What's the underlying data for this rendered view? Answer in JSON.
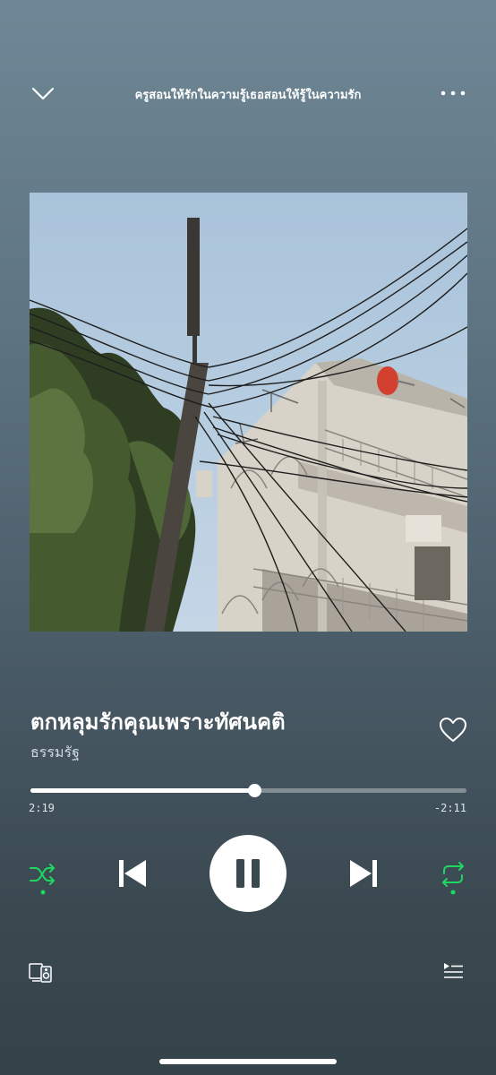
{
  "header": {
    "playlist_title": "ครูสอนให้รักในความรู้เธอสอนให้รู้ในความรัก"
  },
  "track": {
    "title": "ตกหลุมรักคุณเพราะทัศนคติ",
    "artist": "ธรรมรัฐ"
  },
  "progress": {
    "elapsed": "2:19",
    "remaining": "-2:11",
    "fraction": 0.515
  },
  "colors": {
    "accent": "#1ed760",
    "background_top": "#6f8796",
    "background_bottom": "#34424a"
  },
  "icons": {
    "collapse": "chevron-down-icon",
    "more": "more-horizontal-icon",
    "like": "heart-icon",
    "shuffle": "shuffle-icon",
    "previous": "skip-previous-icon",
    "pause": "pause-icon",
    "next": "skip-next-icon",
    "repeat": "repeat-icon",
    "devices": "devices-icon",
    "queue": "queue-icon"
  },
  "state": {
    "shuffle_on": true,
    "repeat_on": true,
    "playing": true
  }
}
